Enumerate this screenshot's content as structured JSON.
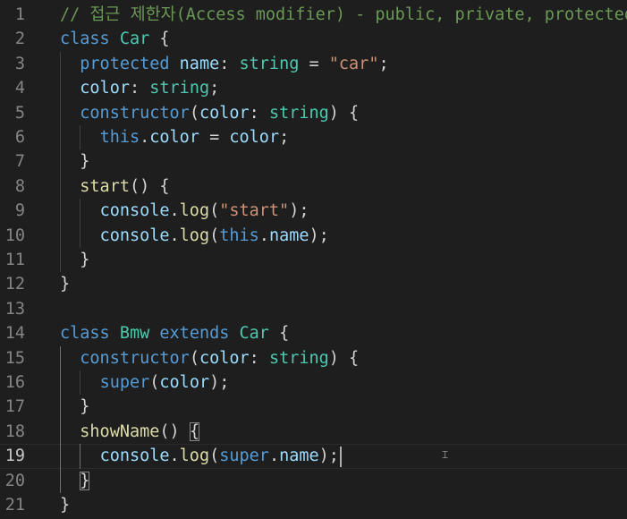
{
  "editor": {
    "language": "typescript",
    "current_line": 19,
    "lines": [
      {
        "n": "1",
        "tokens": [
          {
            "t": "// 접근 제한자(Access modifier) - public, private, protected",
            "c": "cmt"
          }
        ]
      },
      {
        "n": "2",
        "tokens": [
          {
            "t": "class",
            "c": "kw"
          },
          {
            "t": " ",
            "c": "pun"
          },
          {
            "t": "Car",
            "c": "cls"
          },
          {
            "t": " {",
            "c": "pun"
          }
        ]
      },
      {
        "n": "3",
        "tokens": [
          {
            "t": "  ",
            "c": "pun"
          },
          {
            "t": "protected",
            "c": "kw"
          },
          {
            "t": " ",
            "c": "pun"
          },
          {
            "t": "name",
            "c": "prop"
          },
          {
            "t": ": ",
            "c": "pun"
          },
          {
            "t": "string",
            "c": "cls"
          },
          {
            "t": " = ",
            "c": "pun"
          },
          {
            "t": "\"car\"",
            "c": "str"
          },
          {
            "t": ";",
            "c": "pun"
          }
        ]
      },
      {
        "n": "4",
        "tokens": [
          {
            "t": "  ",
            "c": "pun"
          },
          {
            "t": "color",
            "c": "prop"
          },
          {
            "t": ": ",
            "c": "pun"
          },
          {
            "t": "string",
            "c": "cls"
          },
          {
            "t": ";",
            "c": "pun"
          }
        ]
      },
      {
        "n": "5",
        "tokens": [
          {
            "t": "  ",
            "c": "pun"
          },
          {
            "t": "constructor",
            "c": "kw"
          },
          {
            "t": "(",
            "c": "pun"
          },
          {
            "t": "color",
            "c": "prop"
          },
          {
            "t": ": ",
            "c": "pun"
          },
          {
            "t": "string",
            "c": "cls"
          },
          {
            "t": ") {",
            "c": "pun"
          }
        ]
      },
      {
        "n": "6",
        "tokens": [
          {
            "t": "    ",
            "c": "pun"
          },
          {
            "t": "this",
            "c": "kw"
          },
          {
            "t": ".",
            "c": "pun"
          },
          {
            "t": "color",
            "c": "prop"
          },
          {
            "t": " = ",
            "c": "pun"
          },
          {
            "t": "color",
            "c": "prop"
          },
          {
            "t": ";",
            "c": "pun"
          }
        ]
      },
      {
        "n": "7",
        "tokens": [
          {
            "t": "  }",
            "c": "pun"
          }
        ]
      },
      {
        "n": "8",
        "tokens": [
          {
            "t": "  ",
            "c": "pun"
          },
          {
            "t": "start",
            "c": "fn"
          },
          {
            "t": "() {",
            "c": "pun"
          }
        ]
      },
      {
        "n": "9",
        "tokens": [
          {
            "t": "    ",
            "c": "pun"
          },
          {
            "t": "console",
            "c": "prop"
          },
          {
            "t": ".",
            "c": "pun"
          },
          {
            "t": "log",
            "c": "fn"
          },
          {
            "t": "(",
            "c": "pun"
          },
          {
            "t": "\"start\"",
            "c": "str"
          },
          {
            "t": ");",
            "c": "pun"
          }
        ]
      },
      {
        "n": "10",
        "tokens": [
          {
            "t": "    ",
            "c": "pun"
          },
          {
            "t": "console",
            "c": "prop"
          },
          {
            "t": ".",
            "c": "pun"
          },
          {
            "t": "log",
            "c": "fn"
          },
          {
            "t": "(",
            "c": "pun"
          },
          {
            "t": "this",
            "c": "kw"
          },
          {
            "t": ".",
            "c": "pun"
          },
          {
            "t": "name",
            "c": "prop"
          },
          {
            "t": ");",
            "c": "pun"
          }
        ]
      },
      {
        "n": "11",
        "tokens": [
          {
            "t": "  }",
            "c": "pun"
          }
        ]
      },
      {
        "n": "12",
        "tokens": [
          {
            "t": "}",
            "c": "pun"
          }
        ]
      },
      {
        "n": "13",
        "tokens": []
      },
      {
        "n": "14",
        "tokens": [
          {
            "t": "class",
            "c": "kw"
          },
          {
            "t": " ",
            "c": "pun"
          },
          {
            "t": "Bmw",
            "c": "cls"
          },
          {
            "t": " ",
            "c": "pun"
          },
          {
            "t": "extends",
            "c": "kw"
          },
          {
            "t": " ",
            "c": "pun"
          },
          {
            "t": "Car",
            "c": "cls"
          },
          {
            "t": " {",
            "c": "pun"
          }
        ]
      },
      {
        "n": "15",
        "tokens": [
          {
            "t": "  ",
            "c": "pun"
          },
          {
            "t": "constructor",
            "c": "kw"
          },
          {
            "t": "(",
            "c": "pun"
          },
          {
            "t": "color",
            "c": "prop"
          },
          {
            "t": ": ",
            "c": "pun"
          },
          {
            "t": "string",
            "c": "cls"
          },
          {
            "t": ") {",
            "c": "pun"
          }
        ]
      },
      {
        "n": "16",
        "tokens": [
          {
            "t": "    ",
            "c": "pun"
          },
          {
            "t": "super",
            "c": "kw"
          },
          {
            "t": "(",
            "c": "pun"
          },
          {
            "t": "color",
            "c": "prop"
          },
          {
            "t": ");",
            "c": "pun"
          }
        ]
      },
      {
        "n": "17",
        "tokens": [
          {
            "t": "  }",
            "c": "pun"
          }
        ]
      },
      {
        "n": "18",
        "tokens": [
          {
            "t": "  ",
            "c": "pun"
          },
          {
            "t": "showName",
            "c": "fn"
          },
          {
            "t": "() ",
            "c": "pun"
          },
          {
            "t": "{",
            "c": "pun",
            "match": true
          }
        ]
      },
      {
        "n": "19",
        "tokens": [
          {
            "t": "    ",
            "c": "pun"
          },
          {
            "t": "console",
            "c": "prop"
          },
          {
            "t": ".",
            "c": "pun"
          },
          {
            "t": "log",
            "c": "fn"
          },
          {
            "t": "(",
            "c": "pun"
          },
          {
            "t": "super",
            "c": "kw"
          },
          {
            "t": ".",
            "c": "pun"
          },
          {
            "t": "name",
            "c": "prop"
          },
          {
            "t": ");",
            "c": "pun"
          }
        ]
      },
      {
        "n": "20",
        "tokens": [
          {
            "t": "  ",
            "c": "pun"
          },
          {
            "t": "}",
            "c": "pun",
            "match": true
          }
        ]
      },
      {
        "n": "21",
        "tokens": [
          {
            "t": "}",
            "c": "pun"
          }
        ]
      }
    ]
  },
  "colors": {
    "background": "#1e1e1e",
    "comment": "#6a9955",
    "keyword": "#569cd6",
    "type": "#4ec9b0",
    "string": "#ce9178",
    "variable": "#9cdcfe",
    "function": "#dcdcaa",
    "line_number": "#858585"
  }
}
